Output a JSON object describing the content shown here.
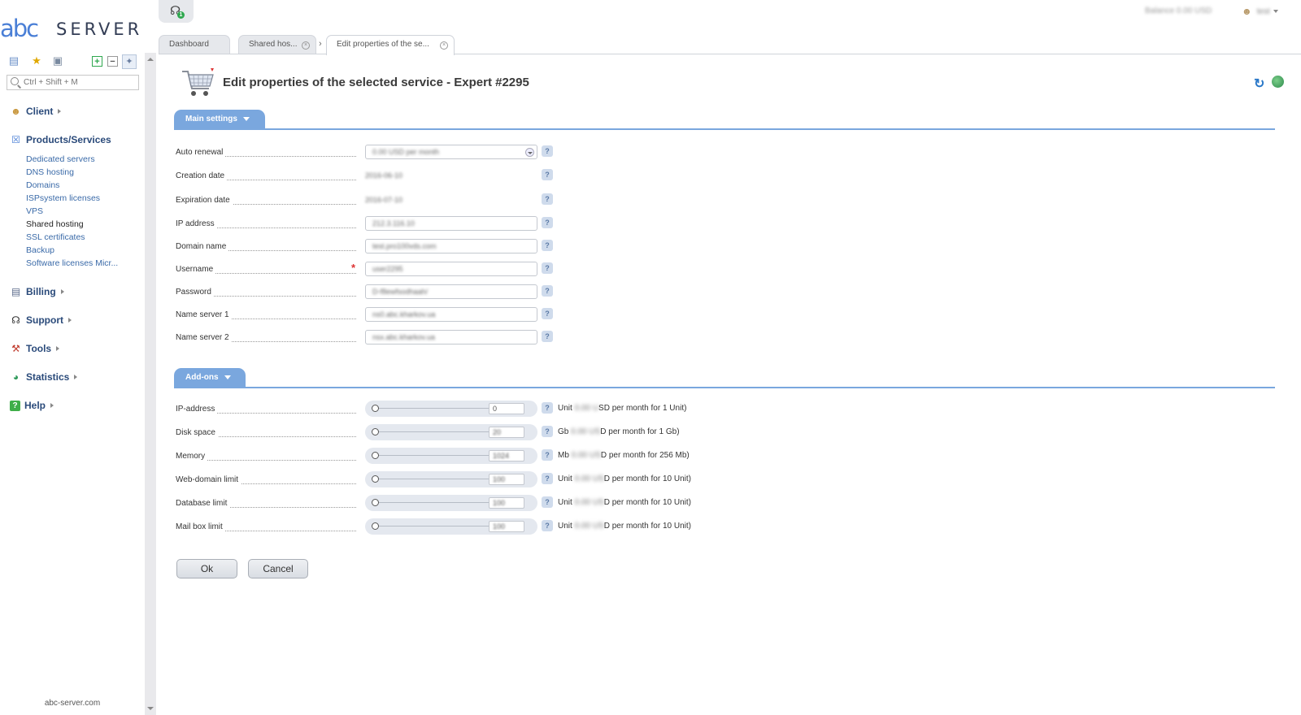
{
  "brand": {
    "logo_mark": "abc",
    "logo_word": "SERVER"
  },
  "sidebar": {
    "search_placeholder": "Ctrl + Shift + M",
    "groups": [
      {
        "label": "Client",
        "icon": "client-icon"
      },
      {
        "label": "Products/Services",
        "icon": "cart-icon"
      },
      {
        "label": "Billing",
        "icon": "billing-icon"
      },
      {
        "label": "Support",
        "icon": "headset-icon"
      },
      {
        "label": "Tools",
        "icon": "tools-icon"
      },
      {
        "label": "Statistics",
        "icon": "pie-chart-icon"
      },
      {
        "label": "Help",
        "icon": "help-icon"
      }
    ],
    "products_items": [
      "Dedicated servers",
      "DNS hosting",
      "Domains",
      "ISPsystem licenses",
      "VPS",
      "Shared hosting",
      "SSL certificates",
      "Backup",
      "Software licenses Micr..."
    ],
    "active_item": "Shared hosting",
    "footer": "abc-server.com"
  },
  "topbar": {
    "alerts_count": "1",
    "balance_text": "Balance 0.00 USD",
    "user_name": "test"
  },
  "tabs": [
    {
      "label": "Dashboard",
      "closable": false
    },
    {
      "label": "Shared hos...",
      "closable": true
    },
    {
      "label": "Edit properties of the se...",
      "closable": true,
      "active": true
    }
  ],
  "page": {
    "title": "Edit properties of the selected service - Expert #2295"
  },
  "main_settings": {
    "section_label": "Main settings",
    "fields": [
      {
        "label": "Auto renewal",
        "type": "select",
        "value": "0.00 USD per month"
      },
      {
        "label": "Creation date",
        "type": "text",
        "value": "2016-06-10"
      },
      {
        "label": "Expiration date",
        "type": "text",
        "value": "2016-07-10"
      },
      {
        "label": "IP address",
        "type": "input",
        "value": "212.3.116.10"
      },
      {
        "label": "Domain name",
        "type": "input",
        "value": "test.pro100vds.com"
      },
      {
        "label": "Username",
        "type": "input",
        "value": "user2295",
        "required": true
      },
      {
        "label": "Password",
        "type": "input",
        "value": "D-f8ewfsodhaah/"
      },
      {
        "label": "Name server 1",
        "type": "input",
        "value": "ns0.abc.kharkov.ua"
      },
      {
        "label": "Name server 2",
        "type": "input",
        "value": "nsx.abc.kharkov.ua"
      }
    ]
  },
  "addons": {
    "section_label": "Add-ons",
    "rows": [
      {
        "label": "IP-address",
        "value": "0",
        "desc_prefix": "Unit",
        "desc_hidden": "0.00 U",
        "desc_suffix": "SD per month for 1 Unit)"
      },
      {
        "label": "Disk space",
        "value": "20",
        "desc_prefix": "Gb",
        "desc_hidden": "0.00 US",
        "desc_suffix": "D per month for 1 Gb)"
      },
      {
        "label": "Memory",
        "value": "1024",
        "desc_prefix": "Mb",
        "desc_hidden": "0.00 US",
        "desc_suffix": "D per month for 256 Mb)"
      },
      {
        "label": "Web-domain limit",
        "value": "100",
        "desc_prefix": "Unit",
        "desc_hidden": "0.00 US",
        "desc_suffix": "D per month for 10 Unit)"
      },
      {
        "label": "Database limit",
        "value": "100",
        "desc_prefix": "Unit",
        "desc_hidden": "0.00 US",
        "desc_suffix": "D per month for 10 Unit)"
      },
      {
        "label": "Mail box limit",
        "value": "100",
        "desc_prefix": "Unit",
        "desc_hidden": "0.00 US",
        "desc_suffix": "D per month for 10 Unit)"
      }
    ]
  },
  "actions": {
    "ok_label": "Ok",
    "cancel_label": "Cancel"
  },
  "help_glyph": "?",
  "required_glyph": "*",
  "colors": {
    "accent": "#7aa7de",
    "link": "#3a6aa8",
    "required": "#dd3333"
  }
}
